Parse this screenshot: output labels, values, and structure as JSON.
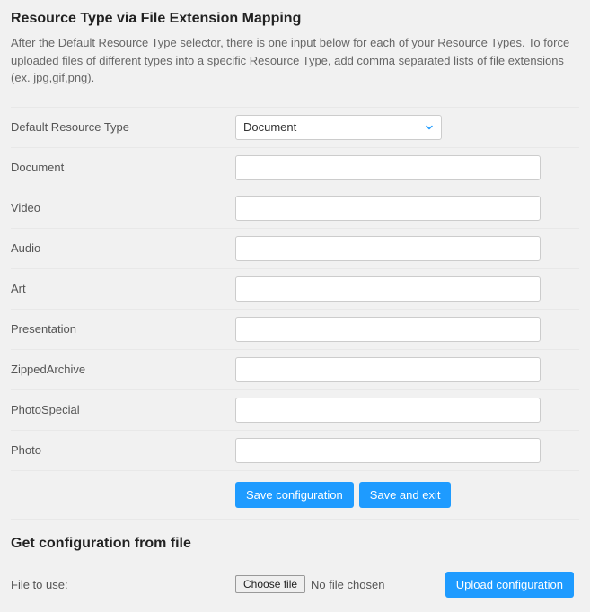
{
  "section1": {
    "title": "Resource Type via File Extension Mapping",
    "description": "After the Default Resource Type selector, there is one input below for each of your Resource Types. To force uploaded files of different types into a specific Resource Type, add comma separated lists of file extensions (ex. jpg,gif,png).",
    "default_label": "Default Resource Type",
    "default_value": "Document",
    "fields": [
      {
        "label": "Document",
        "value": ""
      },
      {
        "label": "Video",
        "value": ""
      },
      {
        "label": "Audio",
        "value": ""
      },
      {
        "label": "Art",
        "value": ""
      },
      {
        "label": "Presentation",
        "value": ""
      },
      {
        "label": "ZippedArchive",
        "value": ""
      },
      {
        "label": "PhotoSpecial",
        "value": ""
      },
      {
        "label": "Photo",
        "value": ""
      }
    ],
    "save_label": "Save configuration",
    "save_exit_label": "Save and exit"
  },
  "section2": {
    "title": "Get configuration from file",
    "file_label": "File to use:",
    "choose_label": "Choose file",
    "no_file_text": "No file chosen",
    "upload_label": "Upload configuration"
  }
}
